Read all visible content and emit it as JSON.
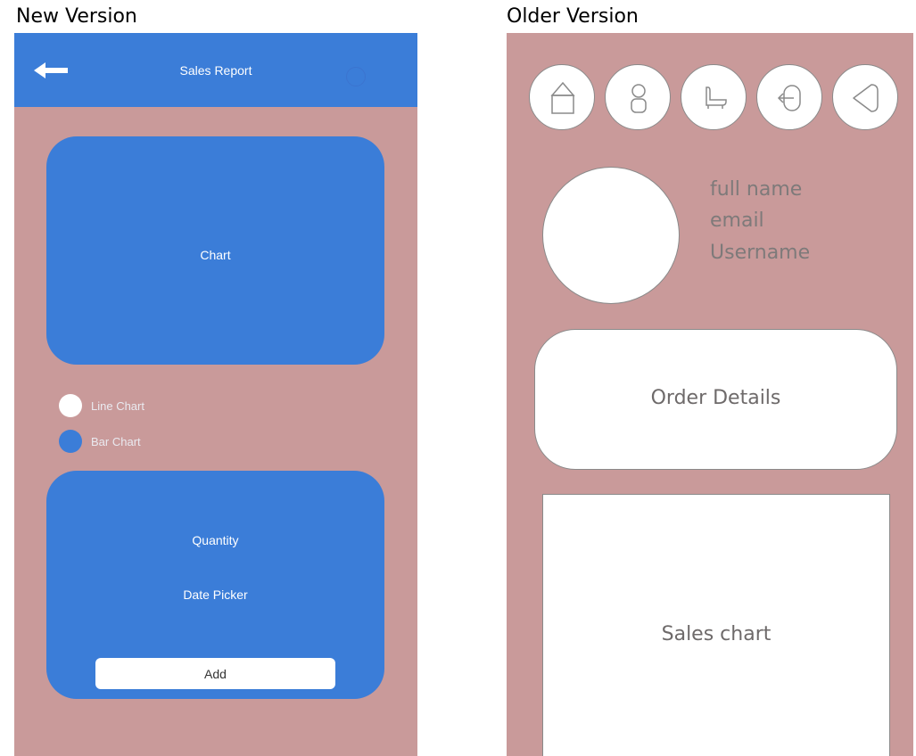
{
  "captions": {
    "new": "New Version",
    "old": "Older Version"
  },
  "colors": {
    "background": "#c99a9a",
    "accent_blue": "#3b7dd8",
    "white": "#ffffff"
  },
  "new_version": {
    "header": {
      "title": "Sales Report",
      "back_icon": "back-arrow-icon",
      "right_icon": "loading-spinner-icon"
    },
    "chart_card": {
      "label": "Chart"
    },
    "chart_type_options": [
      {
        "label": "Line Chart",
        "dot_color": "#ffffff"
      },
      {
        "label": "Bar Chart",
        "dot_color": "#3b7dd8"
      }
    ],
    "form_card": {
      "quantity_label": "Quantity",
      "date_label": "Date Picker",
      "add_label": "Add"
    }
  },
  "older_version": {
    "nav_icons": [
      "home-icon",
      "user-icon",
      "bathtub-icon",
      "logout-icon",
      "tag-icon"
    ],
    "profile": {
      "full_name": "full name",
      "email": "email",
      "username": "Username"
    },
    "order_details_label": "Order Details",
    "sales_chart_label": "Sales chart"
  }
}
